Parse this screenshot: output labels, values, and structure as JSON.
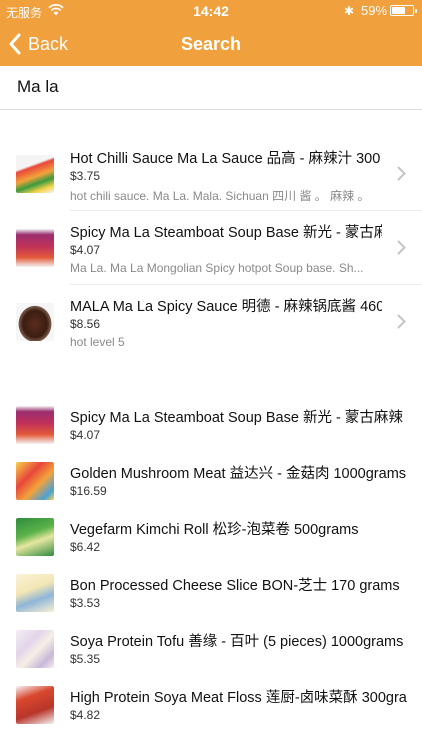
{
  "status_bar": {
    "carrier": "无服务",
    "time": "14:42",
    "battery_percent": "59%",
    "battery_level": 0.59,
    "icons": [
      "wifi-icon",
      "bluetooth-icon",
      "battery-icon"
    ]
  },
  "nav": {
    "back_label": "Back",
    "title": "Search"
  },
  "search": {
    "value": "Ma la"
  },
  "results": [
    {
      "name": "Hot Chilli Sauce Ma La Sauce 品高 - 麻辣汁 300",
      "price": "$3.75",
      "desc": "hot chili sauce. Ma La. Mala. Sichuan 四川 酱 。 麻辣 。"
    },
    {
      "name": "Spicy Ma La Steamboat Soup Base 新光 - 蒙古麻",
      "price": "$4.07",
      "desc": "Ma La. Ma La Mongolian Spicy hotpot Soup base. Sh..."
    },
    {
      "name": "MALA Ma La Spicy Sauce 明德 - 麻辣锅底酱 460",
      "price": "$8.56",
      "desc": "hot level 5"
    }
  ],
  "related": [
    {
      "name": "Spicy Ma La Steamboat Soup Base 新光 - 蒙古麻辣",
      "price": "$4.07"
    },
    {
      "name": "Golden Mushroom Meat 益达兴 - 金菇肉 1000grams",
      "price": "$16.59"
    },
    {
      "name": "Vegefarm Kimchi Roll 松珍-泡菜卷 500grams",
      "price": "$6.42"
    },
    {
      "name": "Bon Processed Cheese Slice BON-芝士 170 grams",
      "price": "$3.53"
    },
    {
      "name": "Soya Protein Tofu 善缘 - 百叶 (5 pieces) 1000grams",
      "price": "$5.35"
    },
    {
      "name": "High Protein Soya Meat Floss 莲厨-卤味菜酥 300gra",
      "price": "$4.82"
    }
  ],
  "colors": {
    "accent": "#f0a03c"
  }
}
